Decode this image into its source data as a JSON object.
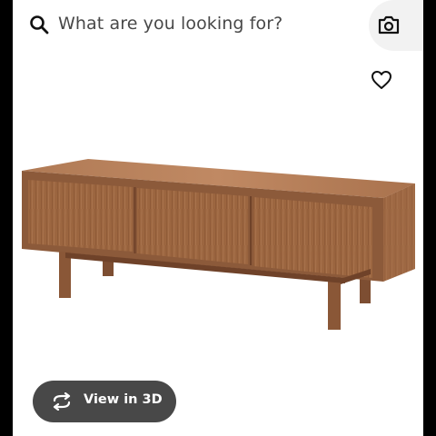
{
  "search": {
    "placeholder": "What are you looking for?"
  },
  "icons": {
    "search": "search-icon",
    "camera": "camera-icon",
    "favorite": "heart-icon",
    "rotate": "rotate-3d-icon"
  },
  "product": {
    "image": "wooden-tv-bench-image"
  },
  "actions": {
    "view_3d_label": "View in 3D"
  },
  "colors": {
    "button_bg": "#484848",
    "text": "#484848",
    "wood": "#a87350"
  }
}
